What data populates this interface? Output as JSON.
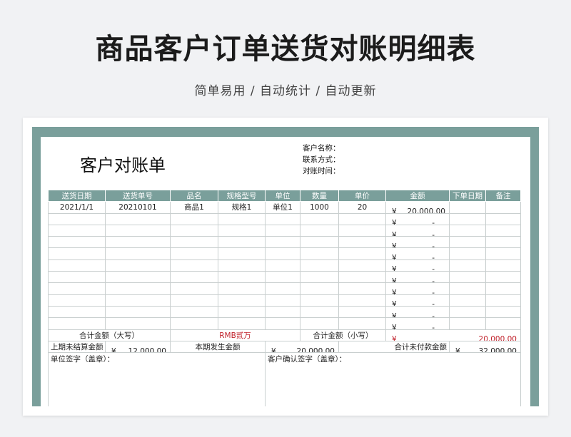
{
  "page": {
    "title": "商品客户订单送货对账明细表",
    "subtitle": "简单易用 / 自动统计 / 自动更新"
  },
  "doc": {
    "title": "客户对账单",
    "customer_name_label": "客户名称：",
    "contact_label": "联系方式：",
    "date_label": "对账时间："
  },
  "table": {
    "headers": [
      "送货日期",
      "送货单号",
      "品名",
      "规格型号",
      "单位",
      "数量",
      "单价",
      "金额",
      "下单日期",
      "备注"
    ],
    "currency_symbol": "¥",
    "empty_amount": "-",
    "rows": [
      {
        "date": "2021/1/1",
        "order_no": "20210101",
        "name": "商品1",
        "spec": "规格1",
        "unit": "单位1",
        "qty": "1000",
        "price": "20",
        "amount": "20,000.00",
        "order_date": "",
        "note": ""
      }
    ]
  },
  "summary": {
    "total_upper_label": "合计金额（大写）",
    "total_upper_value": "RMB贰万",
    "total_lower_label": "合计金额（小写）",
    "total_lower_value": "20,000.00",
    "prev_unsettled_label": "上期未结算金额",
    "prev_unsettled_value": "12,000.00",
    "period_amount_label": "本期发生金额",
    "period_amount_value": "20,000.00",
    "total_unpaid_label": "合计未付款金额",
    "total_unpaid_value": "32,000.00",
    "company_sign_label": "单位签字（盖章）：",
    "customer_sign_label": "客户确认签字（盖章）："
  }
}
